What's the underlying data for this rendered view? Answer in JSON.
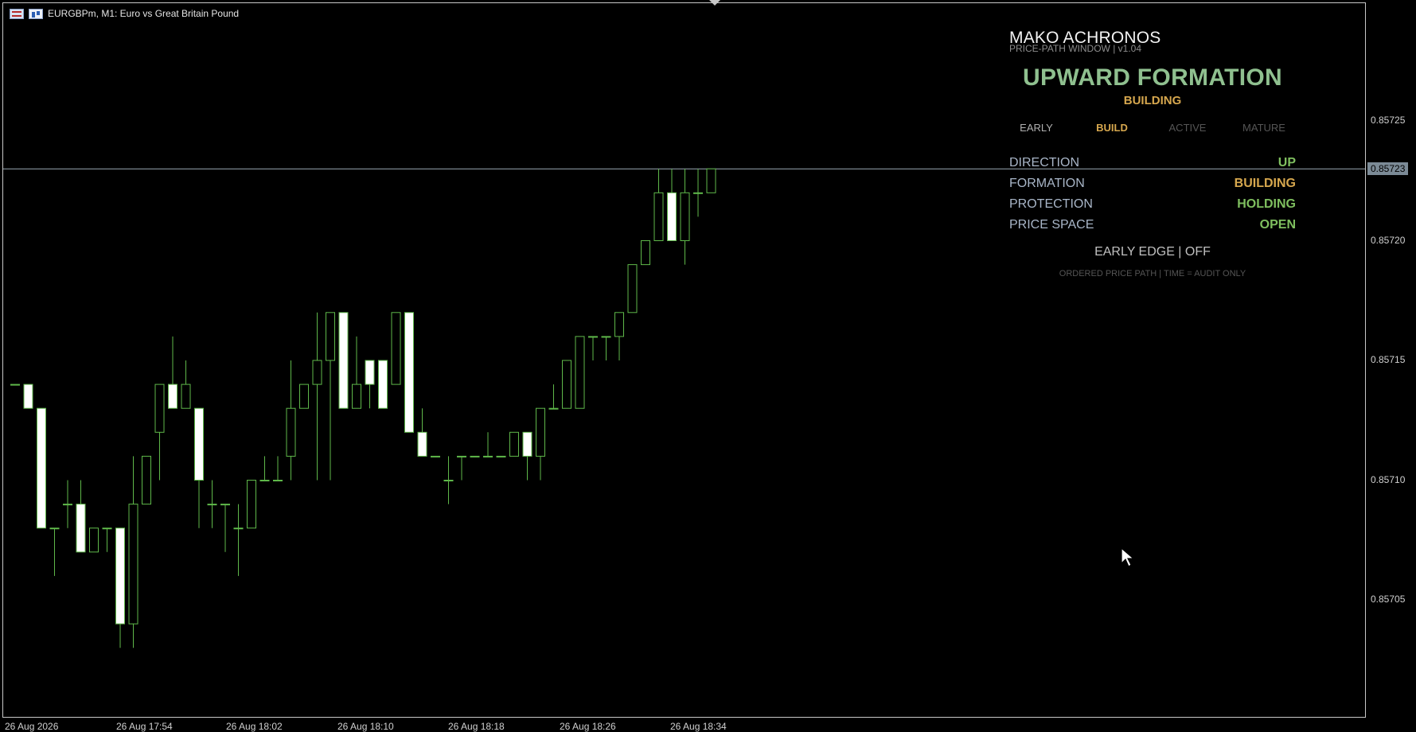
{
  "window": {
    "symbol_title": "EURGBPm, M1:  Euro vs Great Britain Pound"
  },
  "panel": {
    "title": "MAKO ACHRONOS",
    "subtitle": "PRICE-PATH WINDOW  |  v1.04",
    "formation_title": "UPWARD FORMATION",
    "formation_state": "BUILDING",
    "stages": [
      "EARLY",
      "BUILD",
      "ACTIVE",
      "MATURE"
    ],
    "active_stage": "BUILD",
    "rows": [
      {
        "label": "DIRECTION",
        "value": "UP",
        "color": "#7fbf5f"
      },
      {
        "label": "FORMATION",
        "value": "BUILDING",
        "color": "#d6a74e"
      },
      {
        "label": "PROTECTION",
        "value": "HOLDING",
        "color": "#7fbf5f"
      },
      {
        "label": "PRICE SPACE",
        "value": "OPEN",
        "color": "#7fbf5f"
      }
    ],
    "early_edge": "EARLY EDGE  |  OFF",
    "footer": "ORDERED PRICE PATH  |  TIME = AUDIT ONLY"
  },
  "price_axis": {
    "labels": [
      "0.85725",
      "0.85720",
      "0.85715",
      "0.85710",
      "0.85705"
    ],
    "current_price": "0.85723"
  },
  "time_axis": {
    "labels": [
      "26 Aug 2026",
      "26 Aug 17:54",
      "26 Aug 18:02",
      "26 Aug 18:10",
      "26 Aug 18:18",
      "26 Aug 18:26",
      "26 Aug 18:34"
    ]
  },
  "colors": {
    "bull_outline": "#5fb84a",
    "bear_fill": "#ffffff",
    "wick": "#5fb84a",
    "background": "#000000",
    "price_line": "#9aa7b3"
  },
  "chart_data": {
    "type": "candlestick",
    "price_range": [
      0.857,
      0.85726
    ],
    "current_price": 0.85723,
    "candles": [
      {
        "o": 0.85714,
        "h": 0.85714,
        "l": 0.85714,
        "c": 0.85714
      },
      {
        "o": 0.85714,
        "h": 0.85714,
        "l": 0.85713,
        "c": 0.85713
      },
      {
        "o": 0.85713,
        "h": 0.85713,
        "l": 0.85708,
        "c": 0.85708
      },
      {
        "o": 0.85708,
        "h": 0.85708,
        "l": 0.85706,
        "c": 0.85708
      },
      {
        "o": 0.85709,
        "h": 0.8571,
        "l": 0.85708,
        "c": 0.85709
      },
      {
        "o": 0.85709,
        "h": 0.8571,
        "l": 0.85707,
        "c": 0.85707
      },
      {
        "o": 0.85707,
        "h": 0.85708,
        "l": 0.85707,
        "c": 0.85708
      },
      {
        "o": 0.85708,
        "h": 0.85708,
        "l": 0.85707,
        "c": 0.85708
      },
      {
        "o": 0.85708,
        "h": 0.85708,
        "l": 0.85703,
        "c": 0.85704
      },
      {
        "o": 0.85704,
        "h": 0.85711,
        "l": 0.85703,
        "c": 0.85709
      },
      {
        "o": 0.85709,
        "h": 0.85711,
        "l": 0.85709,
        "c": 0.85711
      },
      {
        "o": 0.85712,
        "h": 0.85714,
        "l": 0.8571,
        "c": 0.85714
      },
      {
        "o": 0.85714,
        "h": 0.85716,
        "l": 0.85713,
        "c": 0.85713
      },
      {
        "o": 0.85713,
        "h": 0.85715,
        "l": 0.85713,
        "c": 0.85714
      },
      {
        "o": 0.85713,
        "h": 0.85713,
        "l": 0.85708,
        "c": 0.8571
      },
      {
        "o": 0.85709,
        "h": 0.8571,
        "l": 0.85708,
        "c": 0.85709
      },
      {
        "o": 0.85709,
        "h": 0.85709,
        "l": 0.85707,
        "c": 0.85709
      },
      {
        "o": 0.85708,
        "h": 0.85709,
        "l": 0.85706,
        "c": 0.85708
      },
      {
        "o": 0.85708,
        "h": 0.8571,
        "l": 0.85708,
        "c": 0.8571
      },
      {
        "o": 0.8571,
        "h": 0.85711,
        "l": 0.8571,
        "c": 0.8571
      },
      {
        "o": 0.8571,
        "h": 0.85711,
        "l": 0.8571,
        "c": 0.8571
      },
      {
        "o": 0.85711,
        "h": 0.85715,
        "l": 0.8571,
        "c": 0.85713
      },
      {
        "o": 0.85713,
        "h": 0.85714,
        "l": 0.85713,
        "c": 0.85714
      },
      {
        "o": 0.85714,
        "h": 0.85717,
        "l": 0.8571,
        "c": 0.85715
      },
      {
        "o": 0.85715,
        "h": 0.85717,
        "l": 0.8571,
        "c": 0.85717
      },
      {
        "o": 0.85717,
        "h": 0.85717,
        "l": 0.85713,
        "c": 0.85713
      },
      {
        "o": 0.85713,
        "h": 0.85716,
        "l": 0.85713,
        "c": 0.85714
      },
      {
        "o": 0.85715,
        "h": 0.85715,
        "l": 0.85713,
        "c": 0.85714
      },
      {
        "o": 0.85715,
        "h": 0.85715,
        "l": 0.85713,
        "c": 0.85713
      },
      {
        "o": 0.85714,
        "h": 0.85717,
        "l": 0.85714,
        "c": 0.85717
      },
      {
        "o": 0.85717,
        "h": 0.85717,
        "l": 0.85712,
        "c": 0.85712
      },
      {
        "o": 0.85712,
        "h": 0.85713,
        "l": 0.85711,
        "c": 0.85711
      },
      {
        "o": 0.85711,
        "h": 0.85711,
        "l": 0.85711,
        "c": 0.85711
      },
      {
        "o": 0.8571,
        "h": 0.85711,
        "l": 0.85709,
        "c": 0.8571
      },
      {
        "o": 0.85711,
        "h": 0.85711,
        "l": 0.8571,
        "c": 0.85711
      },
      {
        "o": 0.85711,
        "h": 0.85711,
        "l": 0.85711,
        "c": 0.85711
      },
      {
        "o": 0.85711,
        "h": 0.85712,
        "l": 0.85711,
        "c": 0.85711
      },
      {
        "o": 0.85711,
        "h": 0.85711,
        "l": 0.85711,
        "c": 0.85711
      },
      {
        "o": 0.85711,
        "h": 0.85712,
        "l": 0.85711,
        "c": 0.85712
      },
      {
        "o": 0.85712,
        "h": 0.85712,
        "l": 0.8571,
        "c": 0.85711
      },
      {
        "o": 0.85711,
        "h": 0.85713,
        "l": 0.8571,
        "c": 0.85713
      },
      {
        "o": 0.85713,
        "h": 0.85714,
        "l": 0.85713,
        "c": 0.85713
      },
      {
        "o": 0.85713,
        "h": 0.85715,
        "l": 0.85713,
        "c": 0.85715
      },
      {
        "o": 0.85713,
        "h": 0.85716,
        "l": 0.85713,
        "c": 0.85716
      },
      {
        "o": 0.85716,
        "h": 0.85716,
        "l": 0.85715,
        "c": 0.85716
      },
      {
        "o": 0.85716,
        "h": 0.85716,
        "l": 0.85715,
        "c": 0.85716
      },
      {
        "o": 0.85716,
        "h": 0.85717,
        "l": 0.85715,
        "c": 0.85717
      },
      {
        "o": 0.85717,
        "h": 0.85719,
        "l": 0.85717,
        "c": 0.85719
      },
      {
        "o": 0.85719,
        "h": 0.8572,
        "l": 0.85719,
        "c": 0.8572
      },
      {
        "o": 0.8572,
        "h": 0.85723,
        "l": 0.8572,
        "c": 0.85722
      },
      {
        "o": 0.85722,
        "h": 0.85723,
        "l": 0.8572,
        "c": 0.8572
      },
      {
        "o": 0.8572,
        "h": 0.85723,
        "l": 0.85719,
        "c": 0.85722
      },
      {
        "o": 0.85722,
        "h": 0.85723,
        "l": 0.85721,
        "c": 0.85722
      },
      {
        "o": 0.85722,
        "h": 0.85723,
        "l": 0.85722,
        "c": 0.85723
      }
    ]
  }
}
